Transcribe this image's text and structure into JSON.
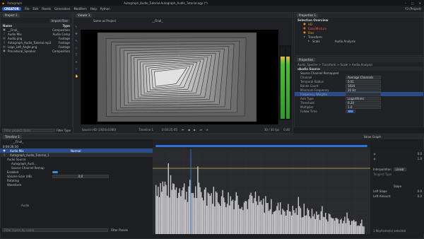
{
  "titlebar": {
    "app": "Autograph",
    "document": "Autograph_Audio_Tutorial-Autograph_Audio_Tutorial.agp (*)"
  },
  "menubar": {
    "badge": "CREATOR",
    "items": [
      "File",
      "Edit",
      "Panels",
      "Generators",
      "Modifiers",
      "Help",
      "Python"
    ],
    "right": "Y3 (Project)"
  },
  "project_panel": {
    "tab": "Project 1",
    "import_label": "Import Files",
    "columns": [
      "Name",
      "Type"
    ],
    "rows": [
      {
        "name": "__Final_",
        "type": "Composition"
      },
      {
        "name": "Audio Mix",
        "type": "Audio Comp"
      },
      {
        "name": "Audio.png",
        "type": "Footage"
      },
      {
        "name": "Autograph_Audio_Tutorial.mp3",
        "type": "Footage"
      },
      {
        "name": "Logo_Left_Angle.png",
        "type": "Footage"
      },
      {
        "name": "Procedural_Speaker",
        "type": "Composition"
      }
    ],
    "filter_placeholder": "Filter project items",
    "filter_type": "Filter Type"
  },
  "viewer": {
    "tab": "Viewer 1",
    "title": "Same as Project",
    "comp": "__Final_",
    "resolution": "Source HD (1920x1080)",
    "timeline": "Timeline 1",
    "timecode": "0:00:25:05",
    "fps": "30 / 30 fps",
    "zoom": "0.46"
  },
  "properties_top": {
    "tab": "Properties 1",
    "header": "Selection Overview",
    "items": [
      {
        "label": "HD",
        "color": "#d9922e"
      },
      {
        "label": "Ease/Mixture",
        "color": "#e05a3c"
      },
      {
        "label": "Bias",
        "color": "#d9922e"
      },
      {
        "label": "Transform",
        "color": "#9aa0a8"
      },
      {
        "label": "Scale",
        "color": "#9aa0a8"
      },
      {
        "label": "Audio Analysis",
        "color": "#9aa0a8"
      }
    ]
  },
  "properties_main": {
    "tab": "Properties",
    "breadcrumb": "Audio_Spectre > Transform > Scale > Audio Analysis",
    "section": "Audio Source",
    "subsection": "Source Channel Remapped",
    "props": [
      {
        "key": "Channel",
        "value": "Average Channels"
      },
      {
        "key": "Temporal Radius",
        "value": "0.01"
      },
      {
        "key": "Bands Count",
        "value": "1024"
      },
      {
        "key": "Minimum Frequency",
        "value": "20 Hz"
      },
      {
        "key": "Frequency Weights",
        "value": ""
      },
      {
        "key": "Axis Type",
        "value": "Logarithmic"
      },
      {
        "key": "Threshold",
        "value": "0.20"
      },
      {
        "key": "Multiplier",
        "value": "1.0"
      },
      {
        "key": "Follow Time",
        "value": ""
      }
    ]
  },
  "timeline": {
    "tab": "Timeline 1",
    "comp": "__Final_",
    "timecode": "0:00:26:30",
    "layer_name": "Audio Mix",
    "blend": "Normal",
    "layer2": "Autograph_Audio_Tutorial_1",
    "sub_items": [
      "Audio Source",
      "Autograph_Audi...",
      "Source Channel Remap",
      "Enabled",
      "Volume Gain (dB)",
      "Rotating",
      "Waveform"
    ],
    "volume": "0.0",
    "value_graph": "Value Graph",
    "filter_placeholder": "Filter layers by name",
    "filter_panels": "Filter Panels"
  },
  "graph_props": {
    "values": [
      "0.0",
      "1.0"
    ],
    "interpolation": "Interpolation",
    "linear": "Linear",
    "tangent_type": "Tangent Type",
    "slope": "Slope",
    "left_slope": "Left Slope",
    "left_amount": "Left Amount",
    "left_slope_val": "0.0",
    "left_amount_val": "0.0",
    "footer": "1 Keyframe(s) selected"
  }
}
